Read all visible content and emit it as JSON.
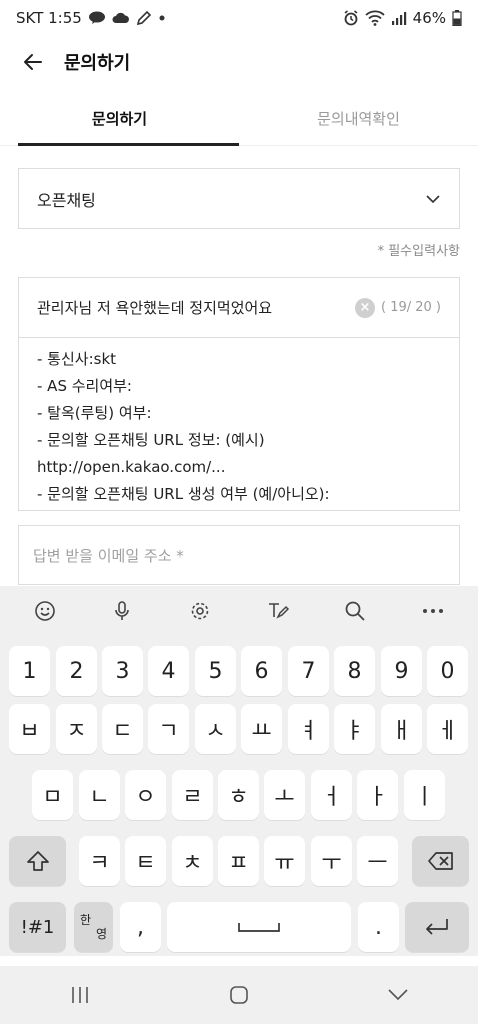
{
  "status": {
    "carrier_time": "SKT 1:55",
    "talk_icon": "talk-bubble-icon",
    "battery": "46%"
  },
  "appbar": {
    "title": "문의하기"
  },
  "tabs": [
    {
      "label": "문의하기",
      "active": true
    },
    {
      "label": "문의내역확인",
      "active": false
    }
  ],
  "form": {
    "category": "오픈채팅",
    "required_note": "* 필수입력사항",
    "subject": "관리자님 저 욕안했는데 정지먹었어요",
    "subject_counter": "( 19/ 20 )",
    "body_lines": [
      "- 통신사:skt",
      "- AS 수리여부:",
      "- 탈옥(루팅) 여부:",
      "- 문의할 오픈채팅 URL 정보: (예시)",
      "http://open.kakao.com/...",
      "- 문의할 오픈채팅 URL 생성 여부 (예/아니오):"
    ],
    "email_placeholder": "답변 받을 이메일 주소 *"
  },
  "keyboard": {
    "toolbar_icons": [
      "emoji-icon",
      "mic-icon",
      "settings-icon",
      "handwriting-icon",
      "search-icon",
      "more-icon"
    ],
    "row_numbers": [
      "1",
      "2",
      "3",
      "4",
      "5",
      "6",
      "7",
      "8",
      "9",
      "0"
    ],
    "row1": [
      "ㅂ",
      "ㅈ",
      "ㄷ",
      "ㄱ",
      "ㅅ",
      "ㅛ",
      "ㅕ",
      "ㅑ",
      "ㅐ",
      "ㅔ"
    ],
    "row2": [
      "ㅁ",
      "ㄴ",
      "ㅇ",
      "ㄹ",
      "ㅎ",
      "ㅗ",
      "ㅓ",
      "ㅏ",
      "ㅣ"
    ],
    "row3": [
      "ㅋ",
      "ㅌ",
      "ㅊ",
      "ㅍ",
      "ㅠ",
      "ㅜ",
      "ㅡ"
    ],
    "symbols_label": "!#1",
    "lang_top": "한",
    "lang_bottom": "영",
    "comma": ",",
    "period": "."
  }
}
